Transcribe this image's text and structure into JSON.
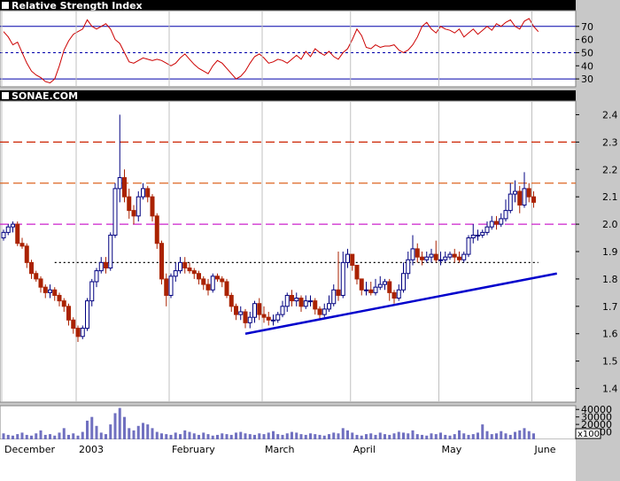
{
  "rsi_panel": {
    "title": "Relative Strength Index",
    "ticks": [
      "70",
      "60",
      "50",
      "40",
      "30"
    ],
    "tick_values": [
      70,
      60,
      50,
      40,
      30
    ],
    "ylim": [
      24,
      82
    ],
    "line_color": "#cc0000",
    "levels": [
      {
        "value": 70,
        "style": "solid",
        "color": "#0000aa"
      },
      {
        "value": 50,
        "style": "dashed",
        "color": "#0000aa"
      },
      {
        "value": 30,
        "style": "solid",
        "color": "#0000aa"
      }
    ],
    "values": [
      66,
      62,
      56,
      58,
      50,
      42,
      36,
      33,
      31,
      28,
      27,
      30,
      40,
      52,
      59,
      64,
      66,
      68,
      75,
      70,
      68,
      70,
      72,
      68,
      60,
      57,
      50,
      43,
      42,
      44,
      46,
      45,
      44,
      45,
      44,
      42,
      40,
      42,
      46,
      49,
      45,
      41,
      38,
      36,
      34,
      40,
      44,
      42,
      38,
      34,
      30,
      32,
      36,
      42,
      47,
      49,
      46,
      42,
      43,
      45,
      44,
      42,
      45,
      48,
      45,
      51,
      47,
      53,
      50,
      48,
      51,
      47,
      45,
      50,
      53,
      60,
      68,
      63,
      54,
      53,
      56,
      54,
      55,
      55,
      56,
      52,
      50,
      52,
      56,
      62,
      70,
      73,
      68,
      65,
      70,
      68,
      67,
      65,
      68,
      62,
      65,
      68,
      64,
      67,
      70,
      67,
      72,
      70,
      73,
      75,
      70,
      68,
      74,
      76,
      70,
      66
    ]
  },
  "price_panel": {
    "title": "SONAE.COM",
    "ticks": [
      "2.4",
      "2.3",
      "2.2",
      "2.1",
      "2.0",
      "1.9",
      "1.8",
      "1.7",
      "1.6",
      "1.5",
      "1.4"
    ],
    "tick_values": [
      2.4,
      2.3,
      2.2,
      2.1,
      2.0,
      1.9,
      1.8,
      1.7,
      1.6,
      1.5,
      1.4
    ],
    "up_color": "#000080",
    "down_color": "#aa2200",
    "hlines": [
      {
        "value": 2.3,
        "color": "#cc2200",
        "dash": "long"
      },
      {
        "value": 2.15,
        "color": "#dd6622",
        "dash": "long"
      },
      {
        "value": 2.0,
        "color": "#cc22cc",
        "dash": "long"
      },
      {
        "value": 1.86,
        "color": "#000000",
        "dash": "dot"
      }
    ]
  },
  "volume_panel": {
    "ticks": [
      "40000",
      "30000",
      "20000",
      "10000"
    ],
    "tick_values": [
      40000,
      30000,
      20000,
      10000
    ],
    "unit_label": "x100",
    "bar_color": "#7070c0"
  },
  "x_axis": {
    "month_labels": [
      {
        "label": "December",
        "index": 0
      },
      {
        "label": "2003",
        "index": 16
      },
      {
        "label": "February",
        "index": 36
      },
      {
        "label": "March",
        "index": 56
      },
      {
        "label": "April",
        "index": 75
      },
      {
        "label": "May",
        "index": 94
      },
      {
        "label": "June",
        "index": 114
      }
    ]
  },
  "chart_data": {
    "type": "candlestick",
    "title": "SONAE.COM",
    "ylim": [
      1.35,
      2.45
    ],
    "open": [
      1.95,
      1.97,
      1.99,
      2.0,
      1.93,
      1.92,
      1.86,
      1.82,
      1.8,
      1.77,
      1.75,
      1.76,
      1.74,
      1.72,
      1.7,
      1.65,
      1.62,
      1.59,
      1.62,
      1.72,
      1.79,
      1.83,
      1.86,
      1.84,
      1.96,
      2.13,
      2.17,
      2.1,
      2.05,
      2.03,
      2.1,
      2.13,
      2.1,
      2.03,
      1.93,
      1.8,
      1.74,
      1.81,
      1.83,
      1.86,
      1.84,
      1.83,
      1.82,
      1.8,
      1.78,
      1.76,
      1.81,
      1.8,
      1.79,
      1.74,
      1.7,
      1.67,
      1.68,
      1.64,
      1.66,
      1.71,
      1.67,
      1.66,
      1.65,
      1.65,
      1.67,
      1.7,
      1.74,
      1.72,
      1.73,
      1.7,
      1.72,
      1.72,
      1.69,
      1.67,
      1.69,
      1.71,
      1.76,
      1.74,
      1.86,
      1.89,
      1.85,
      1.8,
      1.76,
      1.76,
      1.75,
      1.77,
      1.78,
      1.79,
      1.75,
      1.73,
      1.76,
      1.82,
      1.87,
      1.91,
      1.88,
      1.87,
      1.88,
      1.89,
      1.87,
      1.87,
      1.88,
      1.89,
      1.88,
      1.87,
      1.89,
      1.95,
      1.96,
      1.96,
      1.97,
      1.99,
      2.01,
      2.0,
      2.02,
      2.05,
      2.11,
      2.12,
      2.07,
      2.13,
      2.1
    ],
    "close": [
      1.97,
      1.99,
      2.0,
      1.93,
      1.92,
      1.86,
      1.82,
      1.8,
      1.77,
      1.75,
      1.76,
      1.74,
      1.72,
      1.7,
      1.65,
      1.62,
      1.59,
      1.62,
      1.72,
      1.79,
      1.83,
      1.86,
      1.84,
      1.96,
      2.13,
      2.17,
      2.1,
      2.05,
      2.03,
      2.1,
      2.13,
      2.1,
      2.03,
      1.93,
      1.8,
      1.74,
      1.81,
      1.83,
      1.86,
      1.84,
      1.83,
      1.82,
      1.8,
      1.78,
      1.76,
      1.81,
      1.8,
      1.79,
      1.74,
      1.7,
      1.67,
      1.68,
      1.64,
      1.66,
      1.71,
      1.67,
      1.66,
      1.65,
      1.65,
      1.67,
      1.7,
      1.74,
      1.72,
      1.73,
      1.7,
      1.72,
      1.72,
      1.69,
      1.67,
      1.69,
      1.71,
      1.76,
      1.74,
      1.86,
      1.89,
      1.85,
      1.8,
      1.76,
      1.76,
      1.75,
      1.77,
      1.78,
      1.79,
      1.75,
      1.73,
      1.76,
      1.82,
      1.87,
      1.91,
      1.88,
      1.87,
      1.88,
      1.89,
      1.87,
      1.87,
      1.88,
      1.89,
      1.88,
      1.87,
      1.89,
      1.95,
      1.96,
      1.96,
      1.97,
      1.99,
      2.01,
      2.0,
      2.02,
      2.05,
      2.11,
      2.12,
      2.07,
      2.13,
      2.1,
      2.08
    ],
    "high": [
      1.98,
      2.0,
      2.01,
      2.01,
      1.95,
      1.93,
      1.87,
      1.83,
      1.81,
      1.78,
      1.78,
      1.77,
      1.75,
      1.73,
      1.71,
      1.66,
      1.63,
      1.63,
      1.73,
      1.8,
      1.84,
      1.88,
      1.88,
      1.97,
      2.15,
      2.4,
      2.2,
      2.13,
      2.07,
      2.12,
      2.15,
      2.14,
      2.11,
      2.04,
      1.94,
      1.82,
      1.82,
      1.86,
      1.88,
      1.88,
      1.86,
      1.84,
      1.83,
      1.81,
      1.8,
      1.82,
      1.82,
      1.81,
      1.8,
      1.75,
      1.71,
      1.7,
      1.69,
      1.68,
      1.72,
      1.73,
      1.7,
      1.68,
      1.67,
      1.68,
      1.72,
      1.75,
      1.76,
      1.75,
      1.74,
      1.74,
      1.74,
      1.73,
      1.7,
      1.71,
      1.74,
      1.78,
      1.9,
      1.9,
      1.91,
      1.88,
      1.82,
      1.78,
      1.79,
      1.79,
      1.8,
      1.81,
      1.8,
      1.8,
      1.76,
      1.78,
      1.86,
      1.9,
      1.96,
      1.93,
      1.9,
      1.9,
      1.91,
      1.94,
      1.9,
      1.9,
      1.9,
      1.91,
      1.9,
      1.9,
      1.96,
      2.0,
      1.98,
      1.98,
      2.01,
      2.03,
      2.03,
      2.04,
      2.09,
      2.15,
      2.16,
      2.14,
      2.19,
      2.15,
      2.12
    ],
    "low": [
      1.94,
      1.96,
      1.97,
      1.92,
      1.91,
      1.84,
      1.8,
      1.79,
      1.75,
      1.73,
      1.73,
      1.72,
      1.7,
      1.68,
      1.63,
      1.6,
      1.57,
      1.58,
      1.61,
      1.7,
      1.77,
      1.82,
      1.82,
      1.83,
      1.95,
      2.08,
      2.08,
      2.02,
      2.0,
      2.01,
      2.09,
      2.08,
      2.01,
      1.91,
      1.78,
      1.7,
      1.73,
      1.79,
      1.82,
      1.82,
      1.82,
      1.8,
      1.78,
      1.76,
      1.74,
      1.75,
      1.79,
      1.77,
      1.73,
      1.68,
      1.65,
      1.65,
      1.62,
      1.62,
      1.64,
      1.65,
      1.64,
      1.63,
      1.63,
      1.64,
      1.66,
      1.68,
      1.7,
      1.7,
      1.68,
      1.69,
      1.7,
      1.67,
      1.65,
      1.66,
      1.68,
      1.7,
      1.72,
      1.73,
      1.84,
      1.83,
      1.78,
      1.74,
      1.74,
      1.74,
      1.74,
      1.76,
      1.76,
      1.72,
      1.71,
      1.72,
      1.75,
      1.8,
      1.85,
      1.86,
      1.85,
      1.86,
      1.86,
      1.86,
      1.85,
      1.86,
      1.87,
      1.86,
      1.86,
      1.86,
      1.88,
      1.93,
      1.94,
      1.95,
      1.96,
      1.98,
      1.98,
      1.99,
      2.01,
      2.04,
      2.08,
      2.04,
      2.06,
      2.08,
      2.06
    ],
    "volume": [
      800,
      600,
      500,
      700,
      900,
      600,
      500,
      800,
      1200,
      600,
      700,
      500,
      900,
      1500,
      600,
      800,
      500,
      1000,
      2500,
      3000,
      1800,
      900,
      700,
      2000,
      3500,
      4200,
      3000,
      1500,
      1200,
      1800,
      2200,
      2000,
      1500,
      1000,
      800,
      700,
      600,
      900,
      700,
      1200,
      1000,
      800,
      600,
      900,
      700,
      500,
      600,
      800,
      700,
      600,
      900,
      1000,
      800,
      700,
      600,
      800,
      700,
      900,
      1100,
      700,
      600,
      800,
      1000,
      900,
      700,
      600,
      800,
      700,
      600,
      500,
      700,
      900,
      800,
      1500,
      1200,
      900,
      600,
      500,
      700,
      800,
      600,
      900,
      700,
      600,
      800,
      1000,
      900,
      800,
      1200,
      700,
      600,
      500,
      800,
      700,
      900,
      600,
      500,
      700,
      1200,
      800,
      600,
      700,
      900,
      2000,
      1100,
      700,
      800,
      1100,
      800,
      600,
      1000,
      1200,
      1500,
      1100,
      800
    ],
    "volume_scale": [
      0,
      4500
    ],
    "trendlines": [
      {
        "from": [
          52,
          1.6
        ],
        "to": [
          119,
          1.82
        ],
        "color": "#0000cc"
      }
    ]
  }
}
